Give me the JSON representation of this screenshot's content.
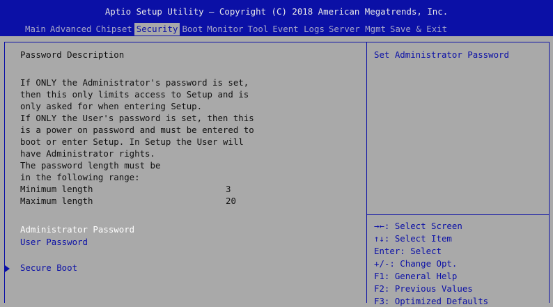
{
  "header": {
    "title": "Aptio Setup Utility – Copyright (C) 2018 American Megatrends, Inc."
  },
  "menu": [
    {
      "label": "Main"
    },
    {
      "label": "Advanced"
    },
    {
      "label": "Chipset"
    },
    {
      "label": "Security",
      "active": true
    },
    {
      "label": "Boot"
    },
    {
      "label": "Monitor"
    },
    {
      "label": "Tool"
    },
    {
      "label": "Event Logs"
    },
    {
      "label": "Server Mgmt"
    },
    {
      "label": "Save & Exit"
    }
  ],
  "left": {
    "section_title": "Password Description",
    "description": [
      "If ONLY the Administrator's password is set,",
      "then this only limits access to Setup and is",
      "only asked for when entering Setup.",
      "If ONLY the User's password is set, then this",
      "is a power on password and must be entered to",
      "boot or enter Setup. In Setup the User will",
      "have Administrator rights.",
      "The password length must be",
      "in the following range:"
    ],
    "min_label": "Minimum length",
    "min_value": "3",
    "max_label": "Maximum length",
    "max_value": "20",
    "admin_password": "Administrator Password",
    "user_password": "User Password",
    "secure_boot": "Secure Boot"
  },
  "right": {
    "help_text": "Set Administrator Password",
    "keys": [
      "→←: Select Screen",
      "↑↓: Select Item",
      "Enter: Select",
      "+/-: Change Opt.",
      "F1: General Help",
      "F2: Previous Values",
      "F3: Optimized Defaults"
    ]
  },
  "colors": {
    "accent_blue": "#0b10a6",
    "background_gray": "#a9a9a9",
    "highlight_white": "#ffffff"
  }
}
